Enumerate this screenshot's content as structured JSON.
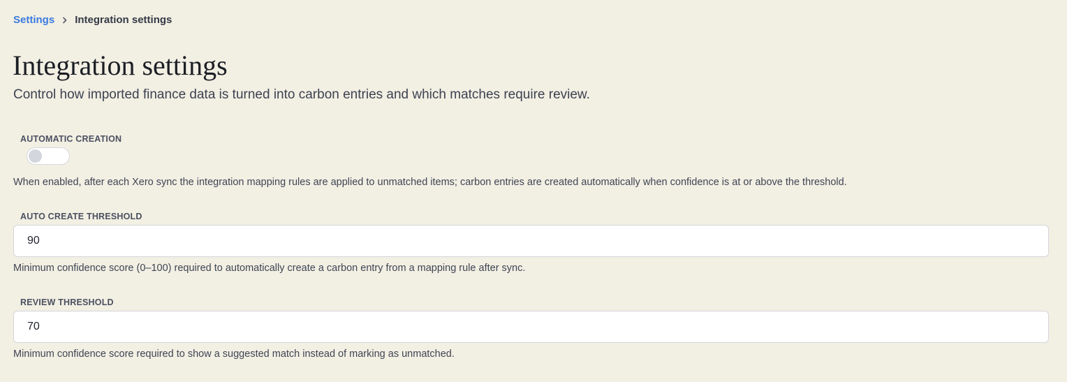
{
  "breadcrumb": {
    "parent": "Settings",
    "current": "Integration settings"
  },
  "page": {
    "title": "Integration settings",
    "subtitle": "Control how imported finance data is turned into carbon entries and which matches require review."
  },
  "automatic_creation": {
    "label": "AUTOMATIC CREATION",
    "enabled": false,
    "help": "When enabled, after each Xero sync the integration mapping rules are applied to unmatched items; carbon entries are created automatically when confidence is at or above the threshold."
  },
  "auto_create_threshold": {
    "label": "AUTO CREATE THRESHOLD",
    "value": "90",
    "help": "Minimum confidence score (0–100) required to automatically create a carbon entry from a mapping rule after sync."
  },
  "review_threshold": {
    "label": "REVIEW THRESHOLD",
    "value": "70",
    "help": "Minimum confidence score required to show a suggested match instead of marking as unmatched."
  },
  "icons": {
    "breadcrumb_separator": "chevron-right-icon"
  },
  "colors": {
    "background": "#f2efe3",
    "link": "#3b7be0",
    "toggle_off_knob": "#d3d6dc"
  }
}
